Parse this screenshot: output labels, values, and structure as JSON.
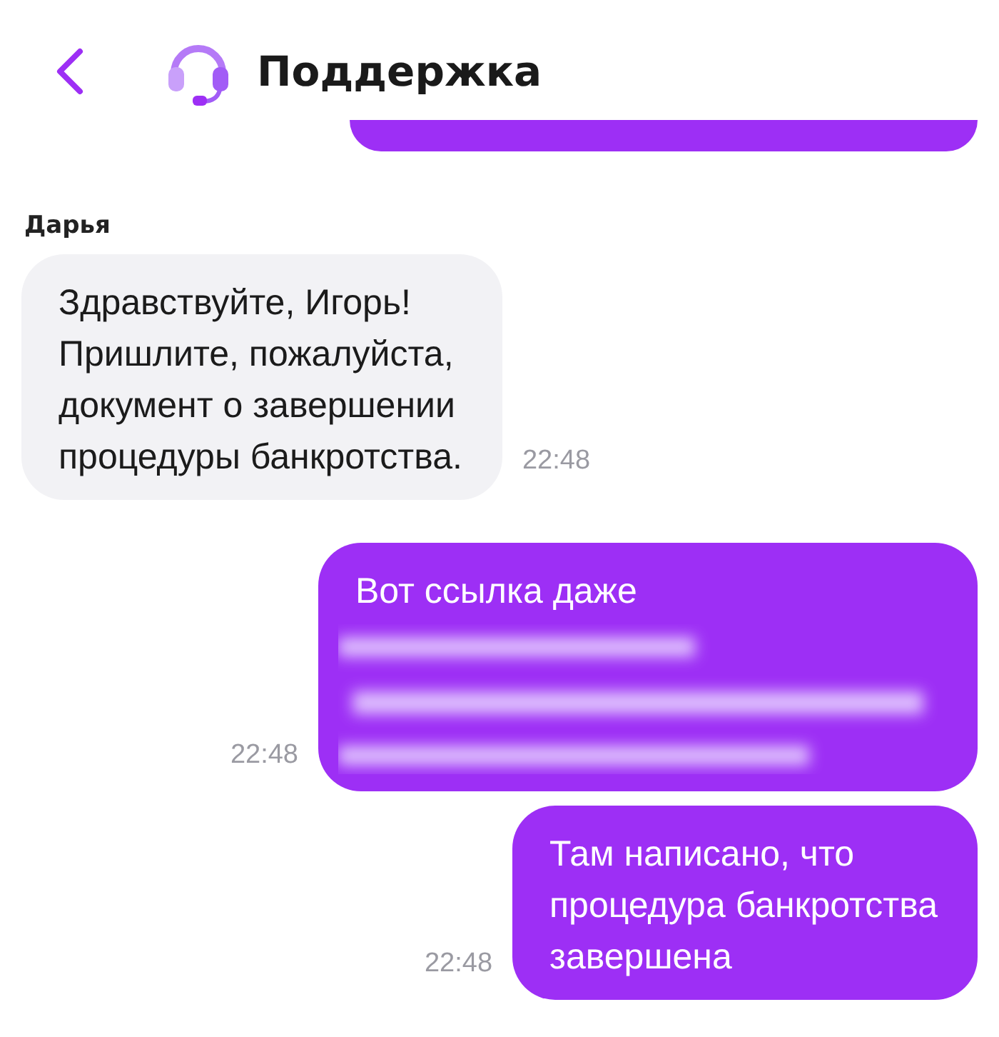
{
  "header": {
    "title": "Поддержка"
  },
  "messages": [
    {
      "kind": "clipped"
    },
    {
      "kind": "incoming",
      "sender": "Дарья",
      "lines": [
        "Здравствуйте, Игорь!",
        "Пришлите, пожалуйста,",
        "документ о завершении",
        "процедуры банкротства."
      ],
      "time": "22:48",
      "redacted": false
    },
    {
      "kind": "outgoing",
      "lines": [
        "Вот ссылка даже"
      ],
      "time": "22:48",
      "redacted": true
    },
    {
      "kind": "outgoing",
      "lines": [
        "Там написано, что",
        "процедура банкротства",
        "завершена"
      ],
      "time": "22:48",
      "redacted": false
    }
  ]
}
